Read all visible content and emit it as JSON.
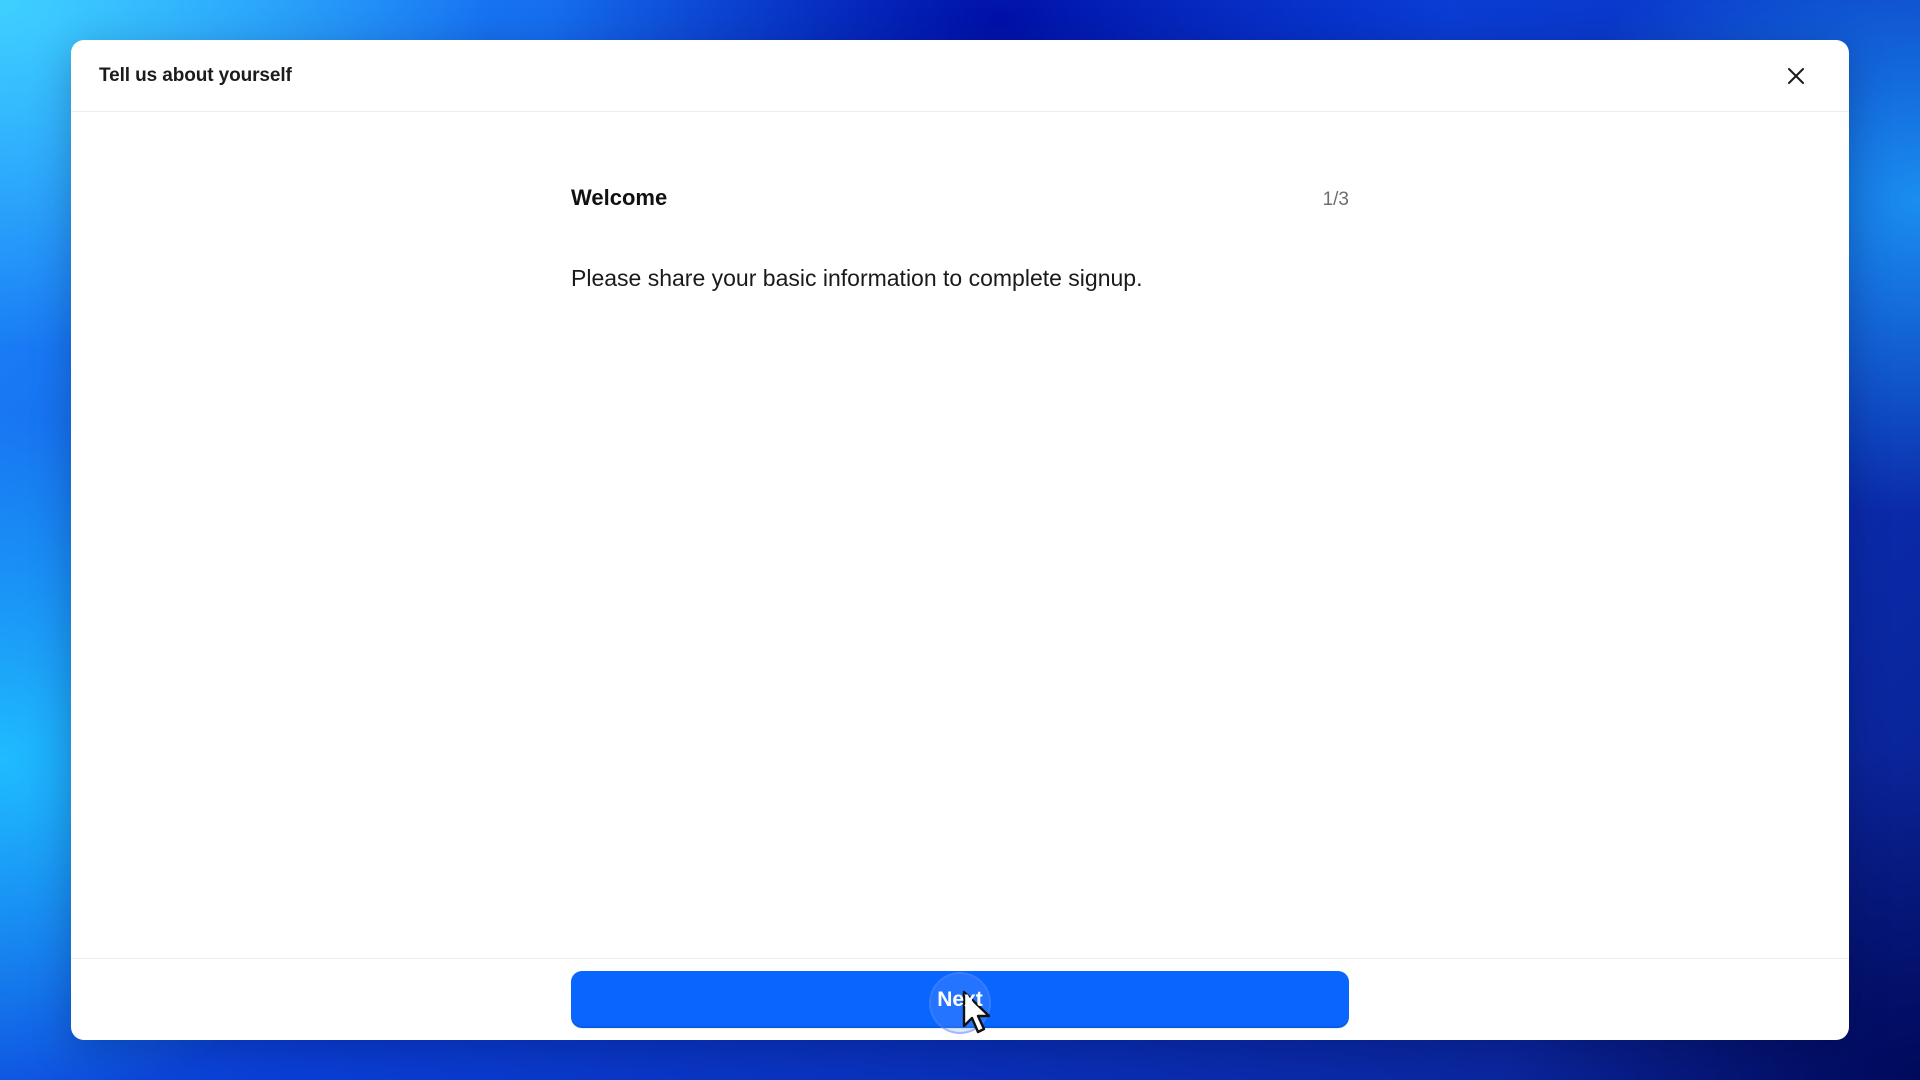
{
  "dialog": {
    "title": "Tell us about yourself",
    "close_icon": "close-icon"
  },
  "step": {
    "title": "Welcome",
    "counter": "1/3",
    "description": "Please share your basic information to complete signup."
  },
  "footer": {
    "next_label": "Next"
  },
  "colors": {
    "accent": "#0866ff",
    "background_primary": "#1e90ff",
    "background_dark": "#0b1f8a"
  }
}
